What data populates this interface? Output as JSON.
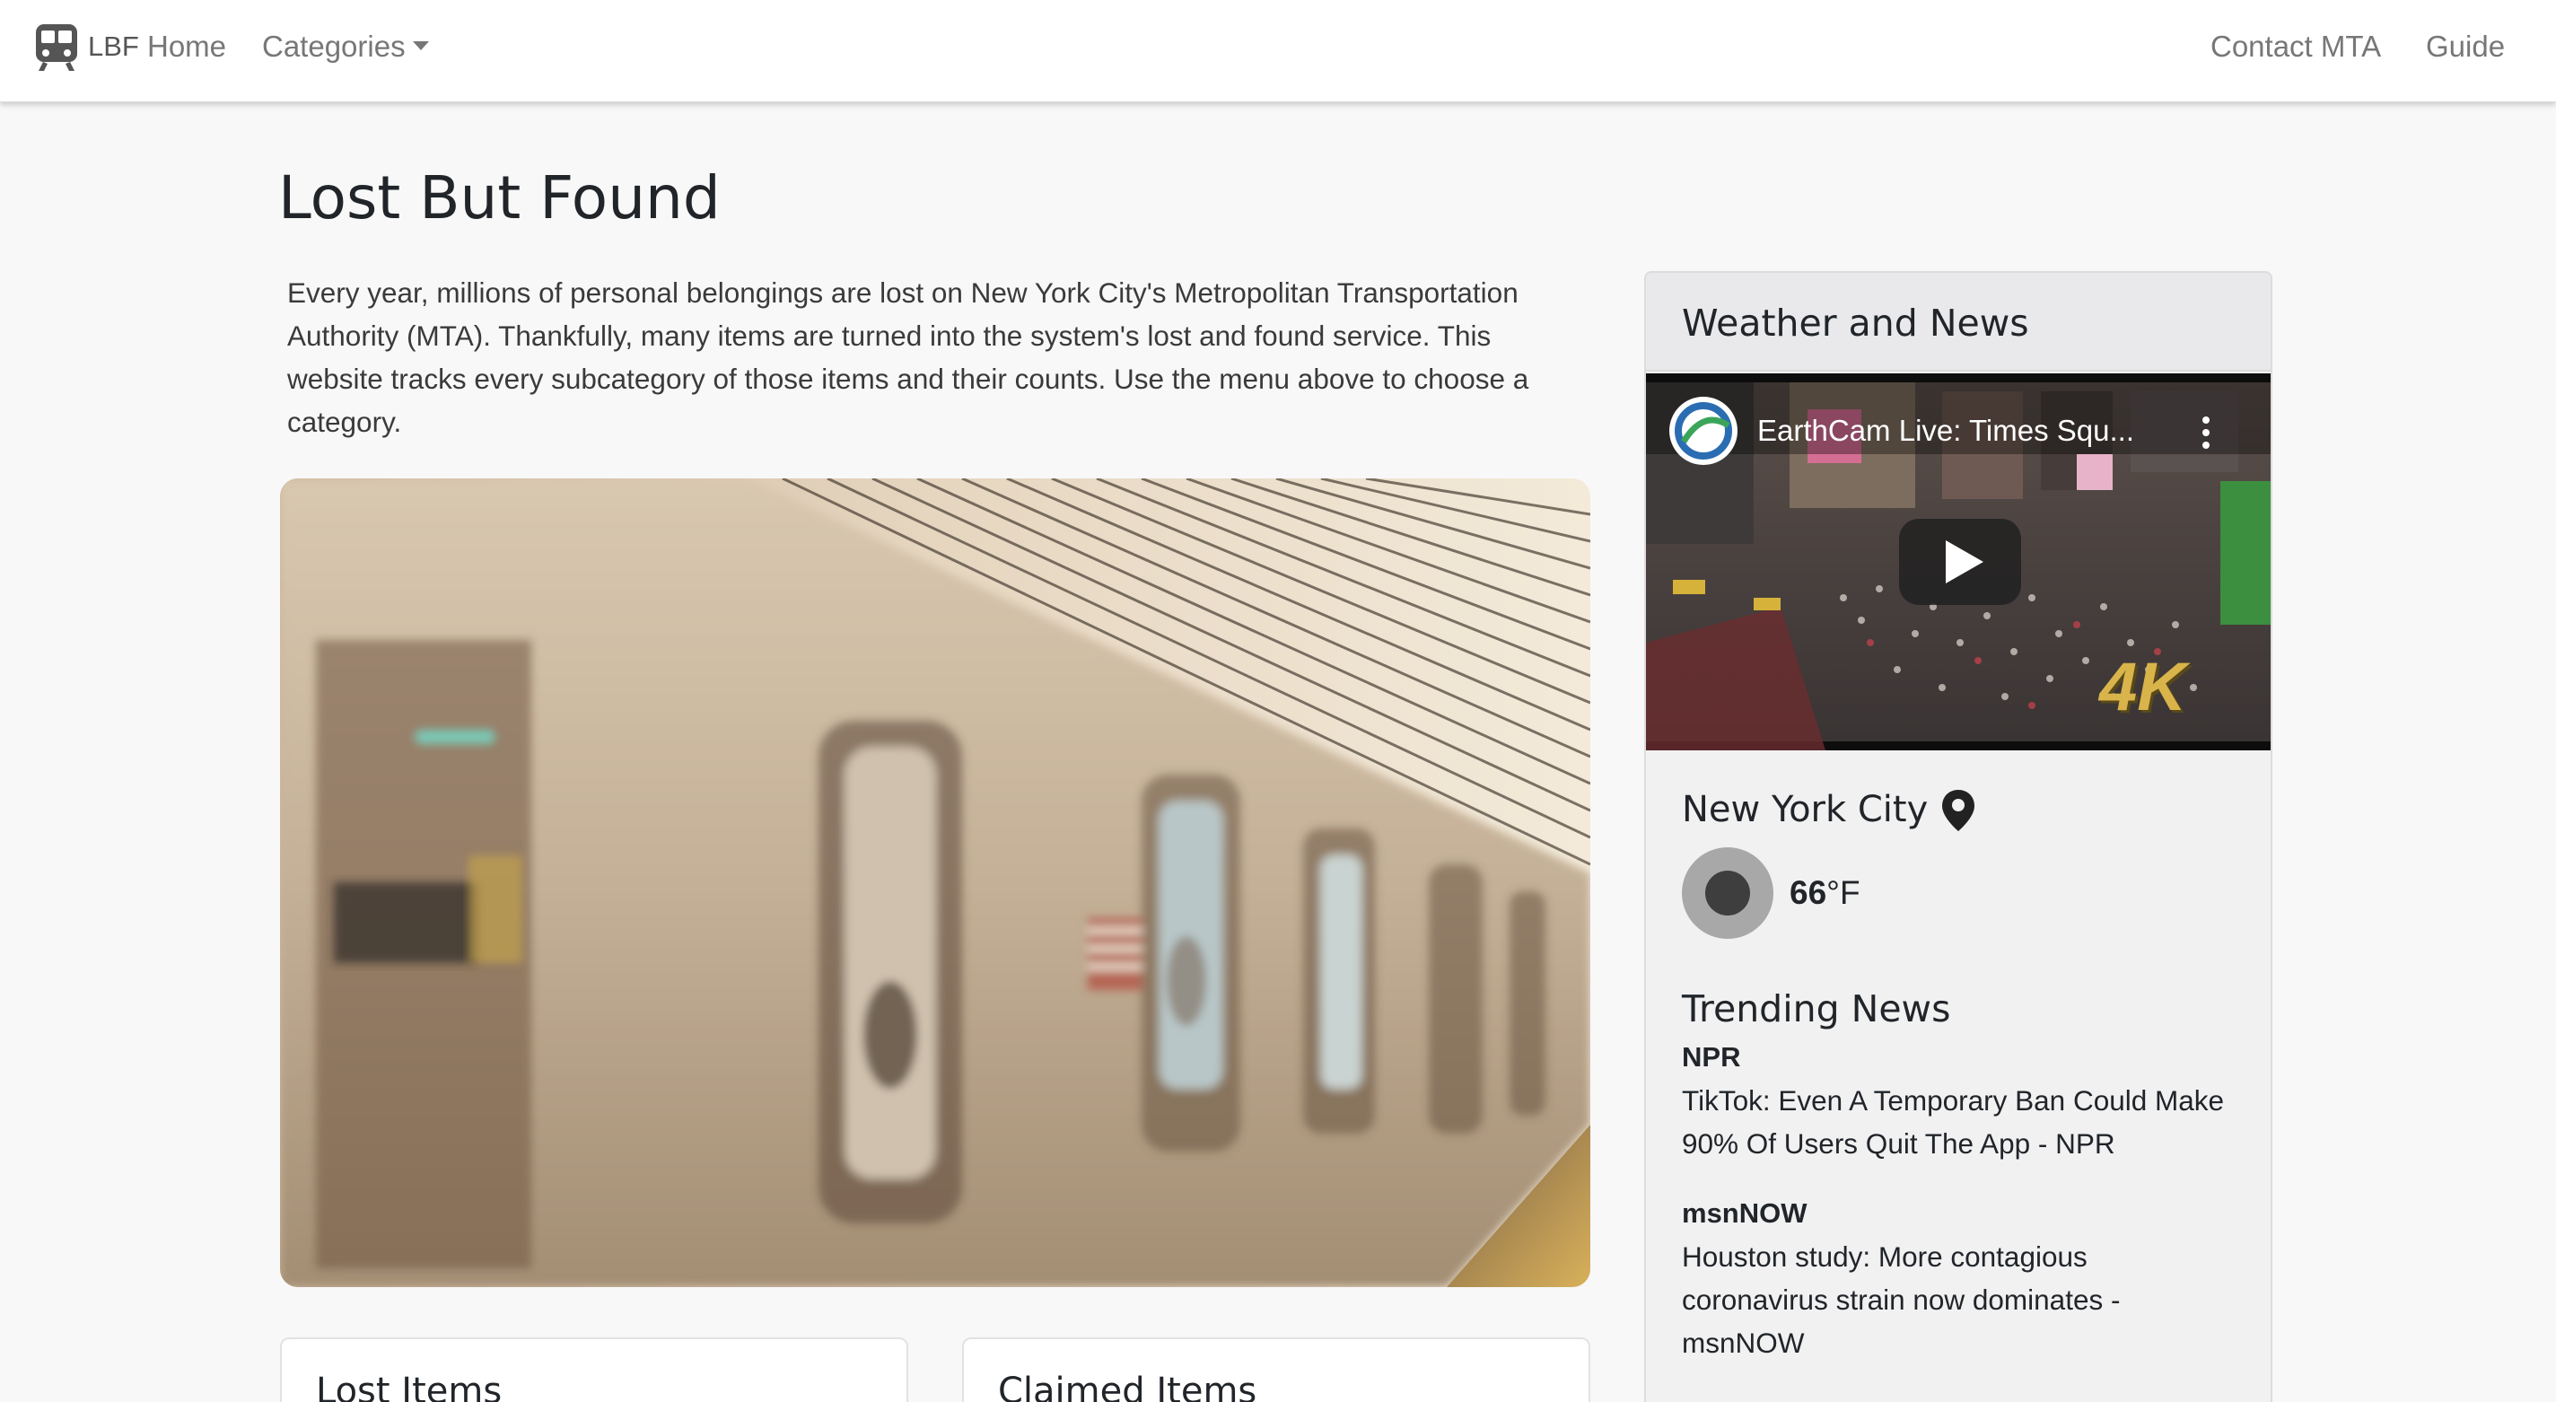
{
  "navbar": {
    "brand": "LBF",
    "home": "Home",
    "categories": "Categories",
    "contact": "Contact MTA",
    "guide": "Guide"
  },
  "page": {
    "title": "Lost But Found",
    "intro": "Every year, millions of personal belongings are lost on New York City's Metropolitan Transportation Authority (MTA). Thankfully, many items are turned into the system's lost and found service. This website tracks every subcategory of those items and their counts. Use the menu above to choose a category."
  },
  "cards": {
    "lost": "Lost Items",
    "claimed": "Claimed Items"
  },
  "side": {
    "header": "Weather and News",
    "video_title": "EarthCam Live: Times Squ...",
    "video_badge": "4K",
    "city": "New York City",
    "temp_value": "66",
    "temp_unit": "°F",
    "trending_title": "Trending News",
    "news": [
      {
        "source": "NPR",
        "title": "TikTok: Even A Temporary Ban Could Make 90% Of Users Quit The App - NPR"
      },
      {
        "source": "msnNOW",
        "title": "Houston study: More contagious coronavirus strain now dominates - msnNOW"
      }
    ]
  },
  "colors": {
    "background": "#f8f8f8",
    "navbar": "#ffffff",
    "nav_text": "#777777",
    "panel": "#f1f1f2"
  }
}
